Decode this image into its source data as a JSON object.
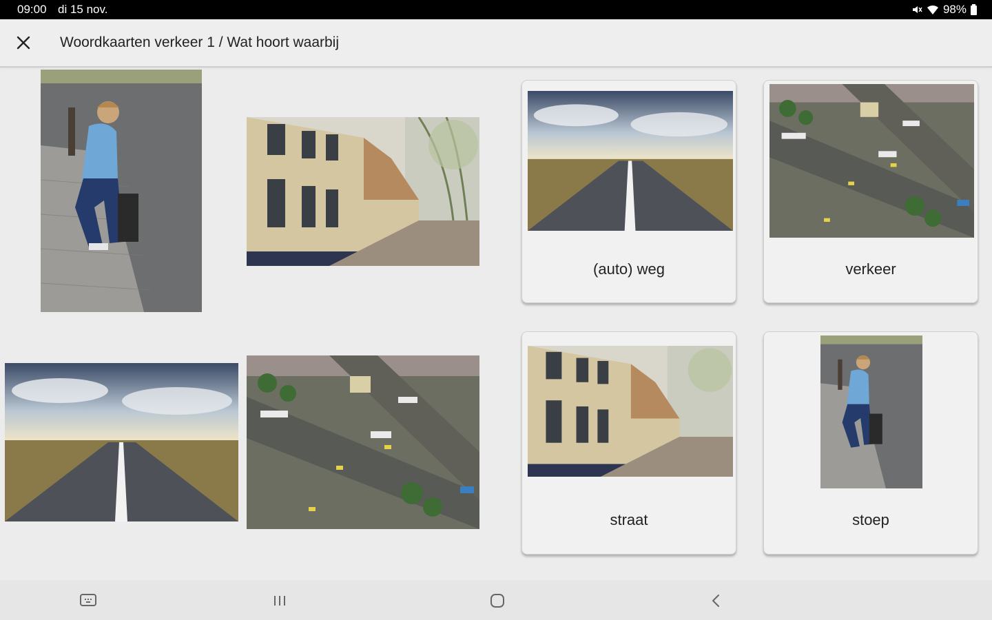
{
  "status_bar": {
    "time": "09:00",
    "date": "di 15 nov.",
    "battery": "98%"
  },
  "app_bar": {
    "title": "Woordkaarten verkeer 1 / Wat hoort waarbij"
  },
  "cards": [
    {
      "label": "(auto) weg"
    },
    {
      "label": "verkeer"
    },
    {
      "label": "straat"
    },
    {
      "label": "stoep"
    }
  ],
  "icons": {
    "close": "close-icon",
    "mute": "mute-icon",
    "wifi": "wifi-icon",
    "battery": "battery-icon",
    "keyboard": "keyboard-icon",
    "recents": "recents-icon",
    "home": "home-icon",
    "back": "back-icon"
  }
}
